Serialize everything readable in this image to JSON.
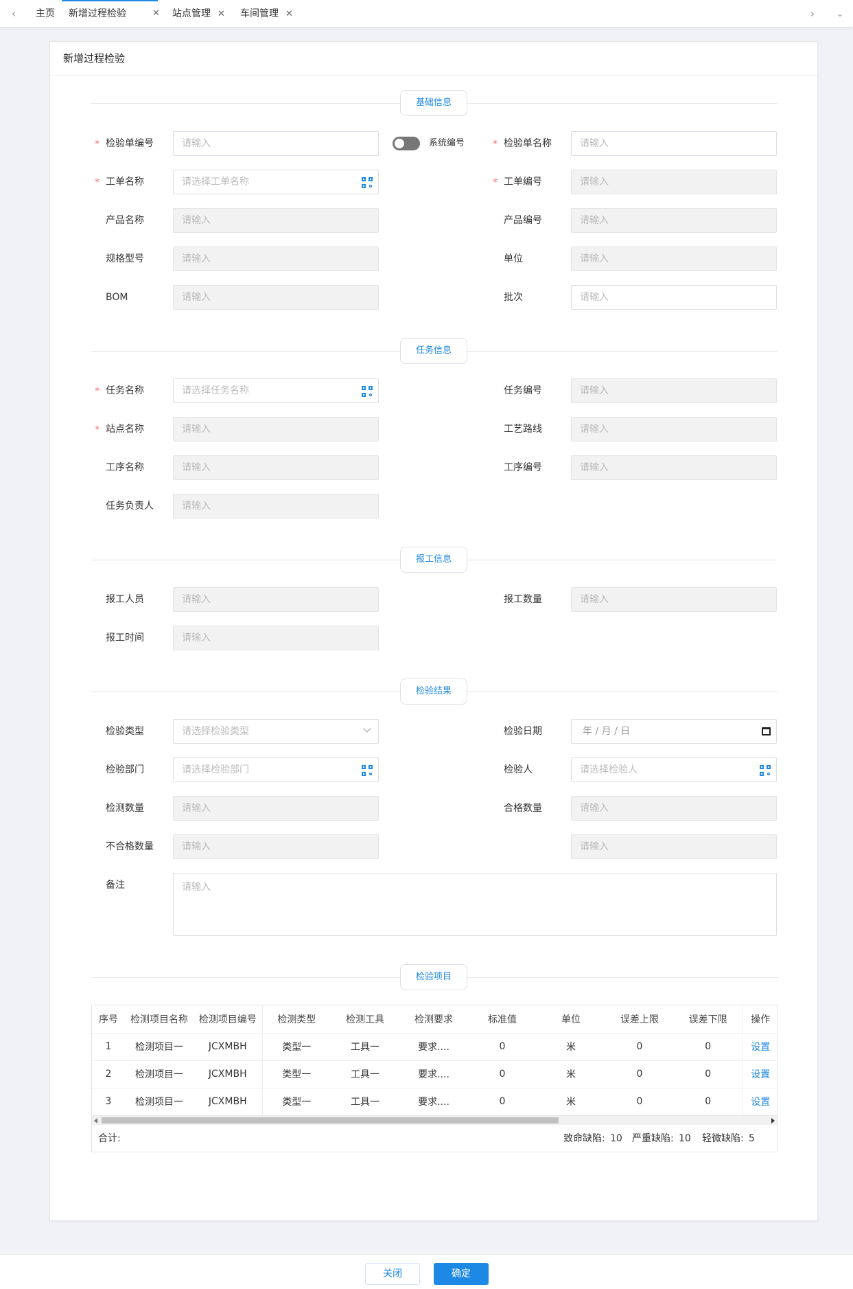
{
  "tabs": {
    "items": [
      {
        "label": "主页",
        "closable": false
      },
      {
        "label": "新增过程检验",
        "closable": true,
        "active": true
      },
      {
        "label": "站点管理",
        "closable": true
      },
      {
        "label": "车间管理",
        "closable": true
      }
    ],
    "close_glyph": "✕"
  },
  "page": {
    "title": "新增过程检验"
  },
  "sections": {
    "basic": "基础信息",
    "task": "任务信息",
    "report": "报工信息",
    "result": "检验结果",
    "items": "检验项目"
  },
  "placeholders": {
    "input": "请输入",
    "work_order_name": "请选择工单名称",
    "task_name": "请选择任务名称",
    "inspect_type": "请选择检验类型",
    "inspect_date": "年 / 月 / 日",
    "inspect_dept": "请选择检验部门",
    "inspector": "请选择检验人"
  },
  "required_mark": "*",
  "basic": {
    "inspect_no": "检验单编号",
    "system_no": "系统编号",
    "inspect_name": "检验单名称",
    "work_order_name": "工单名称",
    "work_order_no": "工单编号",
    "product_name": "产品名称",
    "product_no": "产品编号",
    "spec_model": "规格型号",
    "unit": "单位",
    "bom": "BOM",
    "batch": "批次"
  },
  "task": {
    "task_name": "任务名称",
    "task_no": "任务编号",
    "station_name": "站点名称",
    "process_route": "工艺路线",
    "procedure_name": "工序名称",
    "procedure_no": "工序编号",
    "task_owner": "任务负责人"
  },
  "report": {
    "reporter": "报工人员",
    "report_qty": "报工数量",
    "report_time": "报工时间"
  },
  "result": {
    "inspect_type": "检验类型",
    "inspect_date": "检验日期",
    "inspect_dept": "检验部门",
    "inspector": "检验人",
    "test_qty": "检测数量",
    "pass_qty": "合格数量",
    "fail_qty": "不合格数量",
    "remark": "备注"
  },
  "table": {
    "headers": [
      "序号",
      "检测项目名称",
      "检测项目编号",
      "检测类型",
      "检测工具",
      "检测要求",
      "标准值",
      "单位",
      "误差上限",
      "误差下限",
      "操作"
    ],
    "rows": [
      [
        "1",
        "检测项目一",
        "JCXMBH",
        "类型一",
        "工具一",
        "要求....",
        "0",
        "米",
        "0",
        "0",
        "设置"
      ],
      [
        "2",
        "检测项目一",
        "JCXMBH",
        "类型一",
        "工具一",
        "要求....",
        "0",
        "米",
        "0",
        "0",
        "设置"
      ],
      [
        "3",
        "检测项目一",
        "JCXMBH",
        "类型一",
        "工具一",
        "要求....",
        "0",
        "米",
        "0",
        "0",
        "设置"
      ]
    ],
    "total_label": "合计:",
    "fatal_label": "致命缺陷:",
    "fatal_value": "10",
    "serious_label": "严重缺陷:",
    "serious_value": "10",
    "minor_label": "轻微缺陷:",
    "minor_value": "5"
  },
  "footer": {
    "close": "关闭",
    "confirm": "确定"
  },
  "colors": {
    "accent": "#1e88e5",
    "required": "#f56c6c"
  }
}
